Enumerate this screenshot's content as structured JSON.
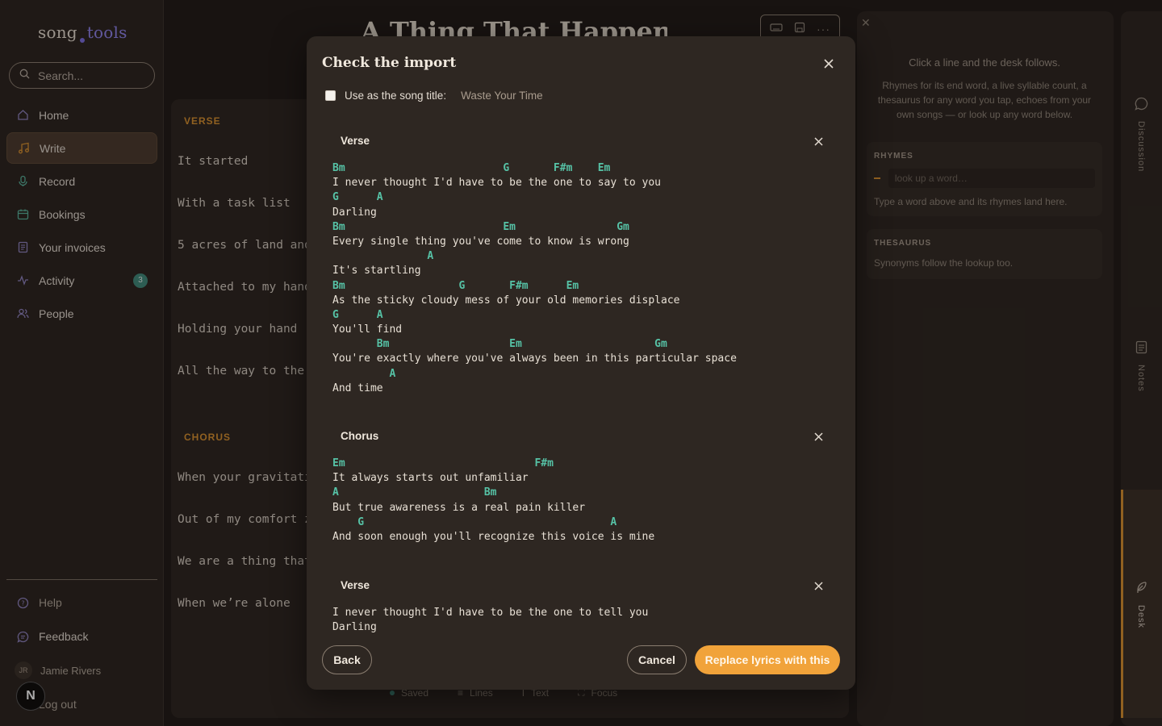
{
  "app": {
    "logo_song": "song",
    "logo_tools": "tools",
    "search_placeholder": "Search...",
    "nav": [
      {
        "label": "Home",
        "icon": "home-icon"
      },
      {
        "label": "Write",
        "icon": "music-note-icon",
        "active": true
      },
      {
        "label": "Record",
        "icon": "microphone-icon"
      },
      {
        "label": "Bookings",
        "icon": "calendar-icon"
      },
      {
        "label": "Your invoices",
        "icon": "document-icon"
      },
      {
        "label": "Activity",
        "icon": "activity-icon",
        "badge": "3"
      },
      {
        "label": "People",
        "icon": "people-icon"
      }
    ],
    "bottom": {
      "help": "Help",
      "feedback": "Feedback",
      "user_initials": "JR",
      "user_name": "Jamie Rivers",
      "logout": "Log out",
      "n_badge": "N"
    }
  },
  "editor": {
    "song_title": "A Thing That Happens",
    "sections": [
      {
        "label": "VERSE",
        "lines": [
          "It started",
          "With a task list",
          "5 acres of land and",
          "Attached to my hand",
          "Holding your hand",
          "All the way to the"
        ]
      },
      {
        "label": "CHORUS",
        "lines": [
          "When your gravitati",
          "Out of my comfort z",
          "We are a thing that",
          "When we’re alone"
        ]
      }
    ],
    "status": {
      "saved": "Saved",
      "lines": "Lines",
      "text": "Text",
      "focus": "Focus"
    }
  },
  "desk": {
    "intro1": "Click a line and the desk follows.",
    "intro2": "Rhymes for its end word, a live syllable count, a thesaurus for any word you tap, echoes from your own songs — or look up any word below.",
    "rhymes_head": "RHYMES",
    "lookup_placeholder": "look up a word…",
    "rhymes_hint": "Type a word above and its rhymes land here.",
    "thesaurus_head": "THESAURUS",
    "thesaurus_hint": "Synonyms follow the lookup too."
  },
  "rail": {
    "discussion": "Discussion",
    "notes": "Notes",
    "desk": "Desk"
  },
  "modal": {
    "title": "Check the import",
    "use_title_label": "Use as the song title:",
    "suggested_title": "Waste Your Time",
    "blocks": [
      {
        "heading": "Verse",
        "lines": [
          {
            "t": "c",
            "s": "Bm                         G       F#m    Em"
          },
          {
            "t": "l",
            "s": "I never thought I'd have to be the one to say to you"
          },
          {
            "t": "c",
            "s": "G      A"
          },
          {
            "t": "l",
            "s": "Darling"
          },
          {
            "t": "c",
            "s": "Bm                         Em                Gm"
          },
          {
            "t": "l",
            "s": "Every single thing you've come to know is wrong"
          },
          {
            "t": "c",
            "s": "               A"
          },
          {
            "t": "l",
            "s": "It's startling"
          },
          {
            "t": "c",
            "s": "Bm                  G       F#m      Em"
          },
          {
            "t": "l",
            "s": "As the sticky cloudy mess of your old memories displace"
          },
          {
            "t": "c",
            "s": "G      A"
          },
          {
            "t": "l",
            "s": "You'll find"
          },
          {
            "t": "c",
            "s": "       Bm                   Em                     Gm"
          },
          {
            "t": "l",
            "s": "You're exactly where you've always been in this particular space"
          },
          {
            "t": "c",
            "s": "         A"
          },
          {
            "t": "l",
            "s": "And time"
          }
        ]
      },
      {
        "heading": "Chorus",
        "lines": [
          {
            "t": "c",
            "s": "Em                              F#m"
          },
          {
            "t": "l",
            "s": "It always starts out unfamiliar"
          },
          {
            "t": "c",
            "s": "A                       Bm"
          },
          {
            "t": "l",
            "s": "But true awareness is a real pain killer"
          },
          {
            "t": "c",
            "s": "    G                                       A"
          },
          {
            "t": "l",
            "s": "And soon enough you'll recognize this voice is mine"
          }
        ]
      },
      {
        "heading": "Verse",
        "lines": [
          {
            "t": "l",
            "s": "I never thought I'd have to be the one to tell you"
          },
          {
            "t": "l",
            "s": "Darling"
          }
        ]
      }
    ],
    "back": "Back",
    "cancel": "Cancel",
    "replace": "Replace lyrics with this"
  },
  "colors": {
    "accent": "#f1a33a",
    "chord": "#56c2a6",
    "section": "#d9912f",
    "badge": "#3f8a7c"
  }
}
